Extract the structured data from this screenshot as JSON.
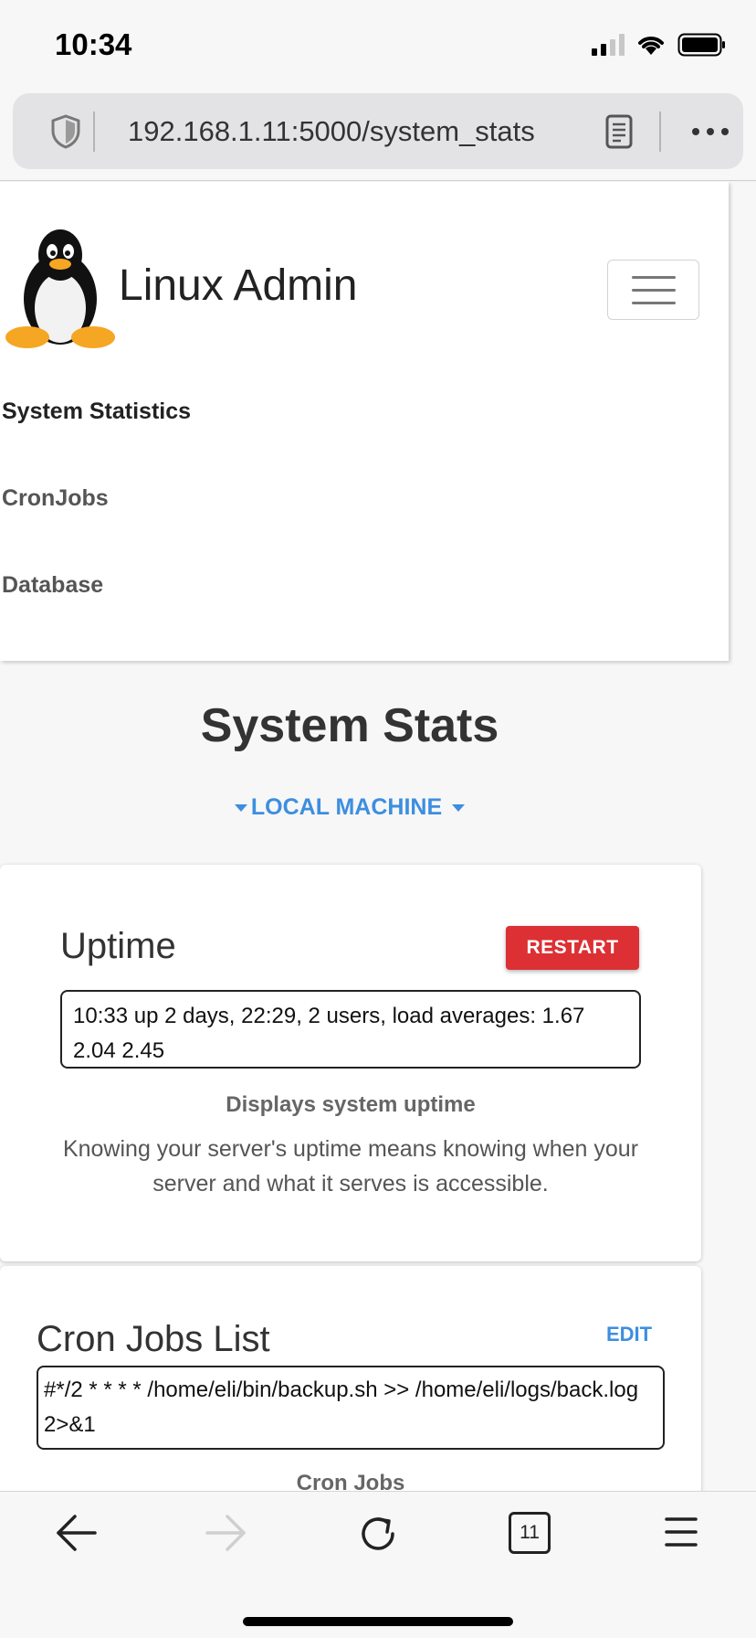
{
  "status_bar": {
    "time": "10:34",
    "icons": [
      "cellular-signal-icon",
      "wifi-icon",
      "battery-icon"
    ]
  },
  "browser": {
    "url": "192.168.1.11:5000/system_stats",
    "icons": [
      "shield-icon",
      "reader-mode-icon",
      "more-options-icon"
    ]
  },
  "navbar": {
    "brand": "Linux Admin",
    "logo": "tux-penguin-logo",
    "items": [
      {
        "label": "System Statistics",
        "active": true
      },
      {
        "label": "CronJobs",
        "active": false
      },
      {
        "label": "Database",
        "active": false
      }
    ]
  },
  "main": {
    "title": "System Stats",
    "machine_select": "LOCAL MACHINE"
  },
  "uptime_card": {
    "title": "Uptime",
    "restart_label": "RESTART",
    "output": "10:33  up 2 days, 22:29, 2 users, load averages: 1.67 2.04 2.45",
    "subtitle": "Displays system uptime",
    "description": "Knowing your server's uptime means knowing when your server and what it serves is accessible."
  },
  "cron_card": {
    "title": "Cron Jobs List",
    "edit_label": "EDIT",
    "output": "#*/2 * * * * /home/eli/bin/backup.sh >> /home/eli/logs/back.log 2>&1",
    "subtitle": "Cron Jobs"
  },
  "toolbar": {
    "tab_count": "11",
    "icons": [
      "back-arrow-icon",
      "forward-arrow-icon",
      "reload-icon",
      "tabs-icon",
      "menu-icon"
    ]
  },
  "colors": {
    "accent": "#3d8ee0",
    "danger": "#dc3034",
    "text": "#333333",
    "background": "#f7f7f7"
  }
}
